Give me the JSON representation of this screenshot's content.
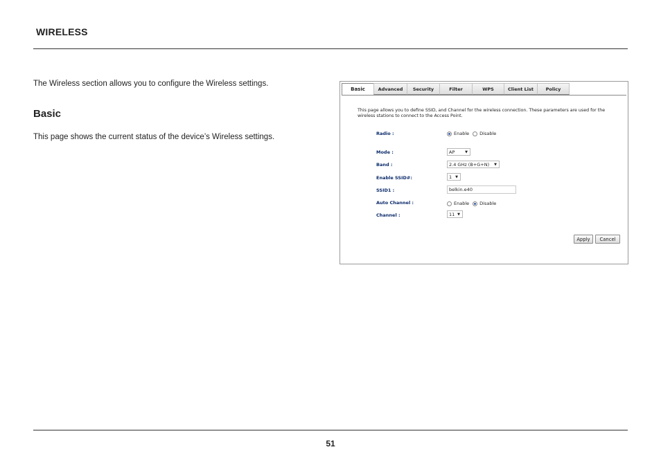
{
  "header": {
    "section_title": "WIRELESS"
  },
  "body": {
    "intro": "The Wireless section allows you to configure the Wireless settings.",
    "subheading": "Basic",
    "description": "This page shows the current status of the device’s Wireless settings."
  },
  "footer": {
    "page_number": "51"
  },
  "screenshot": {
    "tabs": [
      "Basic",
      "Advanced",
      "Security",
      "Filter",
      "WPS",
      "Client List",
      "Policy"
    ],
    "active_tab": "Basic",
    "description": "This page allows you to define SSID, and Channel for the wireless connection. These parameters are used for the wireless stations to connect to the Access Point.",
    "fields": {
      "radio": {
        "label": "Radio :",
        "options": [
          "Enable",
          "Disable"
        ],
        "selected": "Enable"
      },
      "mode": {
        "label": "Mode :",
        "value": "AP"
      },
      "band": {
        "label": "Band :",
        "value": "2.4 GHz (B+G+N)"
      },
      "enable_ssid": {
        "label": "Enable SSID#:",
        "value": "1"
      },
      "ssid1": {
        "label": "SSID1 :",
        "value": "belkin.e40"
      },
      "auto_channel": {
        "label": "Auto Channel :",
        "options": [
          "Enable",
          "Disable"
        ],
        "selected": "Disable"
      },
      "channel": {
        "label": "Channel :",
        "value": "11"
      }
    },
    "buttons": {
      "apply": "Apply",
      "cancel": "Cancel"
    },
    "accent_color": "#0a2a6a"
  }
}
